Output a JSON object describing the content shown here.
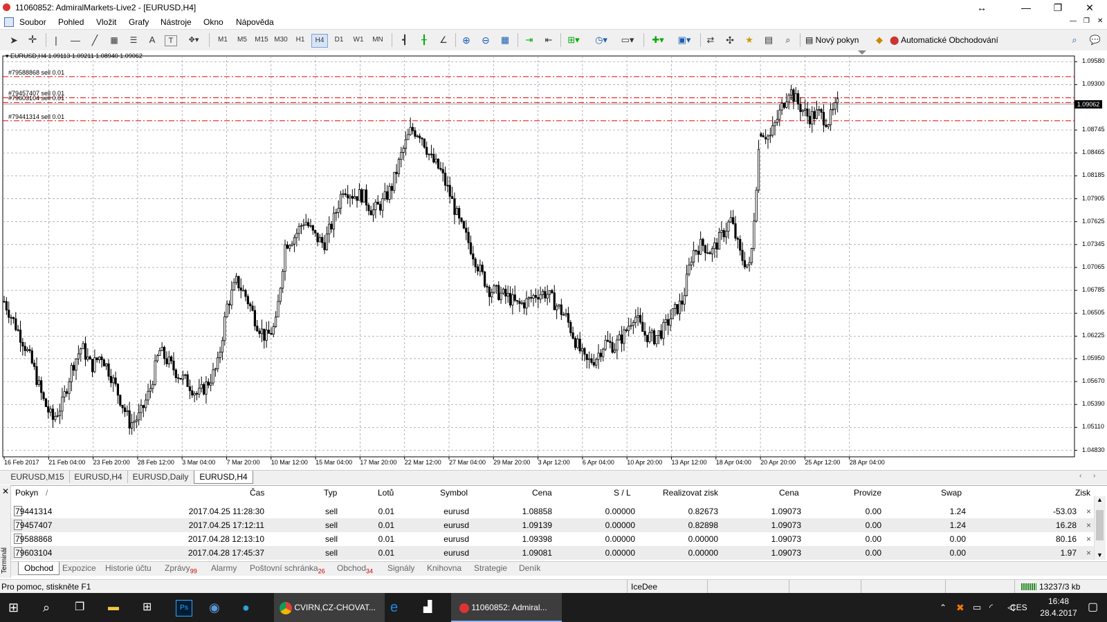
{
  "window": {
    "title": "11060852: AdmiralMarkets-Live2 - [EURUSD,H4]",
    "resize_icon": "↔",
    "minimize_label": "—",
    "restore_label": "❐",
    "close_label": "✕"
  },
  "menu": [
    "Soubor",
    "Pohled",
    "Vložit",
    "Grafy",
    "Nástroje",
    "Okno",
    "Nápověda"
  ],
  "toolbar": {
    "timeframes": [
      "M1",
      "M5",
      "M15",
      "M30",
      "H1",
      "H4",
      "D1",
      "W1",
      "MN"
    ],
    "active_timeframe": "H4",
    "new_order_label": "Nový pokyn",
    "auto_trading_label": "Automatické Obchodování"
  },
  "chart": {
    "header": "EURUSD,H4  1.09113 1.09211 1.08940 1.09062",
    "current_price": "1.09062",
    "order_lines": [
      {
        "label": "#79588868 sell 0.01",
        "price": 1.09398
      },
      {
        "label": "#79457407 sell 0.01",
        "price": 1.09139
      },
      {
        "label": "#79603104 sell 0.01",
        "price": 1.09081
      },
      {
        "label": "#79441314 sell 0.01",
        "price": 1.08858
      }
    ],
    "y_ticks": [
      "1.09580",
      "1.09300",
      "1.09062",
      "1.08745",
      "1.08465",
      "1.08185",
      "1.07905",
      "1.07625",
      "1.07345",
      "1.07065",
      "1.06785",
      "1.06505",
      "1.06225",
      "1.05950",
      "1.05670",
      "1.05390",
      "1.05110",
      "1.04830"
    ],
    "x_ticks": [
      "16 Feb 2017",
      "21 Feb 04:00",
      "23 Feb 20:00",
      "28 Feb 12:00",
      "3 Mar 04:00",
      "7 Mar 20:00",
      "10 Mar 12:00",
      "15 Mar 04:00",
      "17 Mar 20:00",
      "22 Mar 12:00",
      "27 Mar 04:00",
      "29 Mar 20:00",
      "3 Apr 12:00",
      "6 Apr 04:00",
      "10 Apr 20:00",
      "13 Apr 12:00",
      "18 Apr 04:00",
      "20 Apr 20:00",
      "25 Apr 12:00",
      "28 Apr 04:00"
    ]
  },
  "chart_data": {
    "type": "candlestick",
    "symbol": "EURUSD",
    "timeframe": "H4",
    "y_range": [
      1.0475,
      1.0965
    ],
    "close_path": [
      1.0665,
      1.064,
      1.0615,
      1.0585,
      1.0545,
      1.052,
      1.054,
      1.0585,
      1.061,
      1.0585,
      1.06,
      1.0575,
      1.0545,
      1.0515,
      1.0525,
      1.0555,
      1.0605,
      1.059,
      1.0575,
      1.0565,
      1.055,
      1.0565,
      1.0585,
      1.066,
      1.069,
      1.067,
      1.064,
      1.062,
      1.0635,
      1.0735,
      1.0745,
      1.0765,
      1.0745,
      1.0735,
      1.0765,
      1.0805,
      1.0795,
      1.0795,
      1.0775,
      1.0785,
      1.0805,
      1.0845,
      1.0875,
      1.087,
      1.084,
      1.0825,
      1.0795,
      1.076,
      1.0735,
      1.0705,
      1.068,
      1.0675,
      1.067,
      1.066,
      1.0665,
      1.0675,
      1.0675,
      1.066,
      1.0645,
      1.0615,
      1.059,
      1.0595,
      1.0615,
      1.061,
      1.0625,
      1.065,
      1.0625,
      1.062,
      1.063,
      1.065,
      1.0665,
      1.0725,
      1.0735,
      1.0725,
      1.0745,
      1.0765,
      1.072,
      1.0705,
      1.0875,
      1.0865,
      1.0895,
      1.0925,
      1.0905,
      1.089,
      1.0895,
      1.0885,
      1.0905
    ],
    "gap_after_index": 78
  },
  "chart_tabs": [
    "EURUSD,M15",
    "EURUSD,H4",
    "EURUSD,Daily",
    "EURUSD,H4"
  ],
  "active_chart_tab": 3,
  "terminal": {
    "side_label": "Terminál",
    "columns": [
      "Pokyn",
      "/",
      "Čas",
      "Typ",
      "Lotů",
      "Symbol",
      "Cena",
      "S / L",
      "Realizovat zisk",
      "Cena",
      "Provize",
      "Swap",
      "Zisk"
    ],
    "rows": [
      {
        "order": "79441314",
        "time": "2017.04.25 11:28:30",
        "type": "sell",
        "lots": "0.01",
        "symbol": "eurusd",
        "price": "1.08858",
        "sl": "0.00000",
        "tp": "0.82673",
        "cur": "1.09073",
        "comm": "0.00",
        "swap": "1.24",
        "profit": "-53.03"
      },
      {
        "order": "79457407",
        "time": "2017.04.25 17:12:11",
        "type": "sell",
        "lots": "0.01",
        "symbol": "eurusd",
        "price": "1.09139",
        "sl": "0.00000",
        "tp": "0.82898",
        "cur": "1.09073",
        "comm": "0.00",
        "swap": "1.24",
        "profit": "16.28"
      },
      {
        "order": "79588868",
        "time": "2017.04.28 12:13:10",
        "type": "sell",
        "lots": "0.01",
        "symbol": "eurusd",
        "price": "1.09398",
        "sl": "0.00000",
        "tp": "0.00000",
        "cur": "1.09073",
        "comm": "0.00",
        "swap": "0.00",
        "profit": "80.16"
      },
      {
        "order": "79603104",
        "time": "2017.04.28 17:45:37",
        "type": "sell",
        "lots": "0.01",
        "symbol": "eurusd",
        "price": "1.09081",
        "sl": "0.00000",
        "tp": "0.00000",
        "cur": "1.09073",
        "comm": "0.00",
        "swap": "0.00",
        "profit": "1.97"
      }
    ],
    "tabs": [
      {
        "label": "Obchod",
        "badge": ""
      },
      {
        "label": "Expozice",
        "badge": ""
      },
      {
        "label": "Historie účtu",
        "badge": ""
      },
      {
        "label": "Zprávy",
        "badge": "99"
      },
      {
        "label": "Alarmy",
        "badge": ""
      },
      {
        "label": "Poštovní schránka",
        "badge": "26"
      },
      {
        "label": "Obchod",
        "badge": "34"
      },
      {
        "label": "Signály",
        "badge": ""
      },
      {
        "label": "Knihovna",
        "badge": ""
      },
      {
        "label": "Strategie",
        "badge": ""
      },
      {
        "label": "Deník",
        "badge": ""
      }
    ]
  },
  "status": {
    "help": "Pro pomoc, stiskněte F1",
    "profile": "IceDee",
    "traffic": "13237/3 kb"
  },
  "taskbar": {
    "apps": [
      "CVIRN,CZ-CHOVAT...",
      "11060852: Admiral..."
    ],
    "lang": "CES",
    "time": "16:48",
    "date": "28.4.2017"
  }
}
